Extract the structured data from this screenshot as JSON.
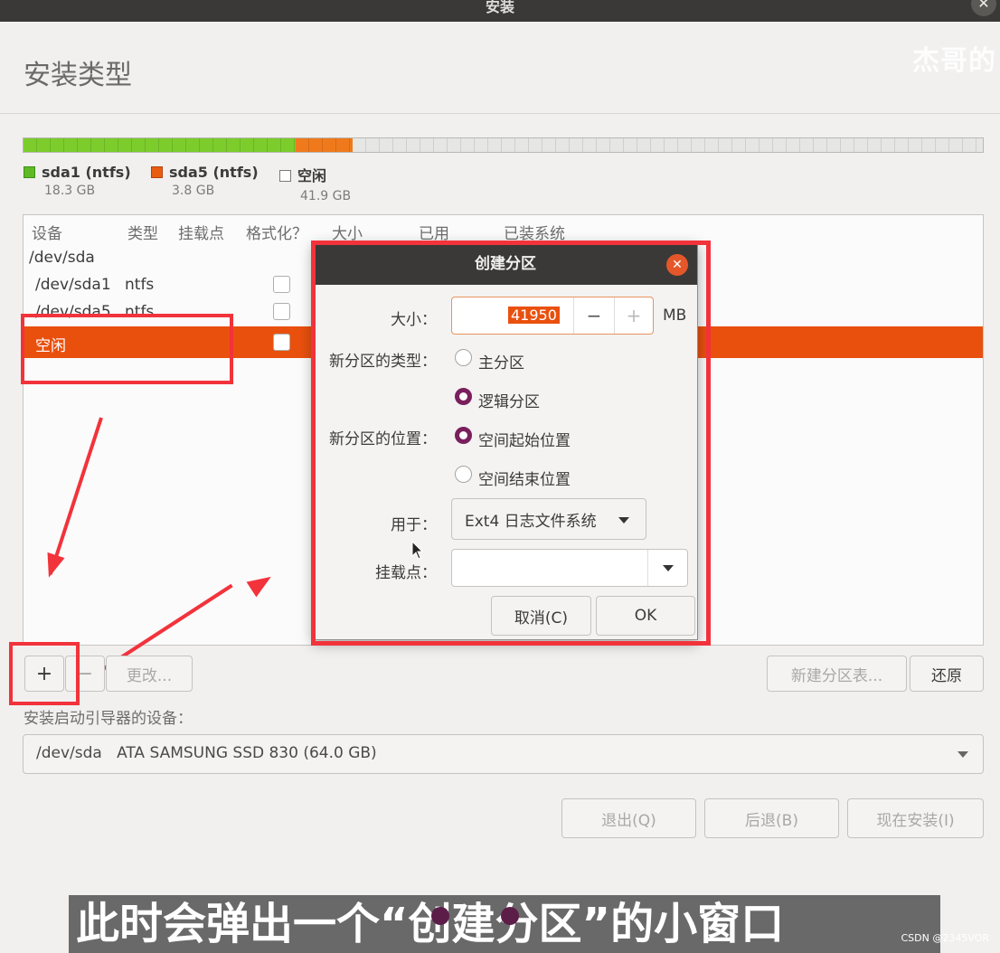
{
  "window": {
    "title": "安装",
    "close_icon": "✕"
  },
  "page": {
    "heading": "安装类型",
    "watermark": "杰哥的"
  },
  "partition_bar": {
    "segments": [
      {
        "name": "sda1",
        "fraction": 0.284,
        "color": "#7ccd2c"
      },
      {
        "name": "sda5",
        "fraction": 0.059,
        "color": "#f07a1b"
      },
      {
        "name": "free",
        "fraction": 0.657,
        "color": "#e4e4e2"
      }
    ]
  },
  "legend": [
    {
      "label": "sda1 (ntfs)",
      "size": "18.3 GB",
      "color": "#5fba25"
    },
    {
      "label": "sda5 (ntfs)",
      "size": "3.8 GB",
      "color": "#e85d12"
    },
    {
      "label": "空闲",
      "size": "41.9 GB",
      "color": "#ffffff"
    }
  ],
  "table": {
    "headers": [
      "设备",
      "类型",
      "挂载点",
      "格式化？",
      "大小",
      "已用",
      "已装系统"
    ],
    "rows": [
      {
        "device": "/dev/sda",
        "type": ""
      },
      {
        "device": "/dev/sda1",
        "type": "ntfs"
      },
      {
        "device": "/dev/sda5",
        "type": "ntfs"
      },
      {
        "device": "空闲",
        "type": "",
        "selected": true
      }
    ]
  },
  "toolbar": {
    "add_label": "+",
    "remove_label": "−",
    "change_label": "更改...",
    "new_table_label": "新建分区表...",
    "revert_label": "还原"
  },
  "boot": {
    "label": "安装启动引导器的设备：",
    "device": "/dev/sda",
    "description": "ATA SAMSUNG SSD 830 (64.0 GB)"
  },
  "footer": {
    "quit": "退出(Q)",
    "back": "后退(B)",
    "install": "现在安装(I)"
  },
  "dialog": {
    "title": "创建分区",
    "close_icon": "✕",
    "size_label": "大小：",
    "size_value": "41950",
    "size_unit": "MB",
    "minus": "−",
    "plus": "+",
    "type_label": "新分区的类型：",
    "type_options": [
      "主分区",
      "逻辑分区"
    ],
    "type_selected": 1,
    "location_label": "新分区的位置：",
    "location_options": [
      "空间起始位置",
      "空间结束位置"
    ],
    "location_selected": 0,
    "use_label": "用于：",
    "use_value": "Ext4 日志文件系统",
    "mount_label": "挂载点：",
    "mount_value": "",
    "cancel": "取消(C)",
    "ok": "OK"
  },
  "caption": {
    "text": "此时会弹出一个“创建分区”的小窗口",
    "credit": "CSDN @2345VOR"
  }
}
